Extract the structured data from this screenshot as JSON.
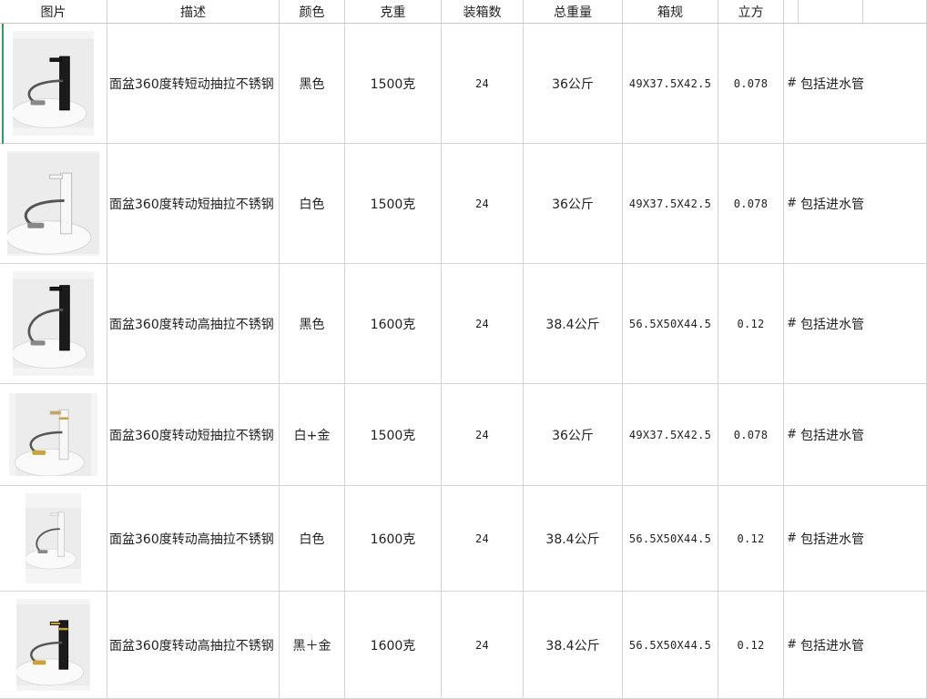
{
  "headers": [
    "图片",
    "描述",
    "颜色",
    "克重",
    "装箱数",
    "总重量",
    "箱规",
    "立方",
    "",
    "",
    ""
  ],
  "rows": [
    {
      "desc": "面盆360度转短动抽拉不锈钢",
      "color": "黑色",
      "weight": "1500克",
      "qty": "24",
      "total": "36公斤",
      "box": "49X37.5X42.5",
      "cube": "0.078",
      "hash": "#",
      "note": "包括进水管",
      "img": "black-faucet-icon"
    },
    {
      "desc": "面盆360度转动短抽拉不锈钢",
      "color": "白色",
      "weight": "1500克",
      "qty": "24",
      "total": "36公斤",
      "box": "49X37.5X42.5",
      "cube": "0.078",
      "hash": "#",
      "note": "包括进水管",
      "img": "white-faucet-icon"
    },
    {
      "desc": "面盆360度转动高抽拉不锈钢",
      "color": "黑色",
      "weight": "1600克",
      "qty": "24",
      "total": "38.4公斤",
      "box": "56.5X50X44.5",
      "cube": "0.12",
      "hash": "#",
      "note": "包括进水管",
      "img": "black-tall-faucet-icon"
    },
    {
      "desc": "面盆360度转动短抽拉不锈钢",
      "color": "白+金",
      "weight": "1500克",
      "qty": "24",
      "total": "36公斤",
      "box": "49X37.5X42.5",
      "cube": "0.078",
      "hash": "#",
      "note": "包括进水管",
      "img": "white-gold-faucet-icon"
    },
    {
      "desc": "面盆360度转动高抽拉不锈钢",
      "color": "白色",
      "weight": "1600克",
      "qty": "24",
      "total": "38.4公斤",
      "box": "56.5X50X44.5",
      "cube": "0.12",
      "hash": "#",
      "note": "包括进水管",
      "img": "white-tall-faucet-icon"
    },
    {
      "desc": "面盆360度转动高抽拉不锈钢",
      "color": "黑＋金",
      "weight": "1600克",
      "qty": "24",
      "total": "38.4公斤",
      "box": "56.5X50X44.5",
      "cube": "0.12",
      "hash": "#",
      "note": "包括进水管",
      "img": "black-gold-faucet-icon"
    }
  ],
  "colors": {
    "grid": "#d4d4d4",
    "selection": "#2e9c5e"
  }
}
